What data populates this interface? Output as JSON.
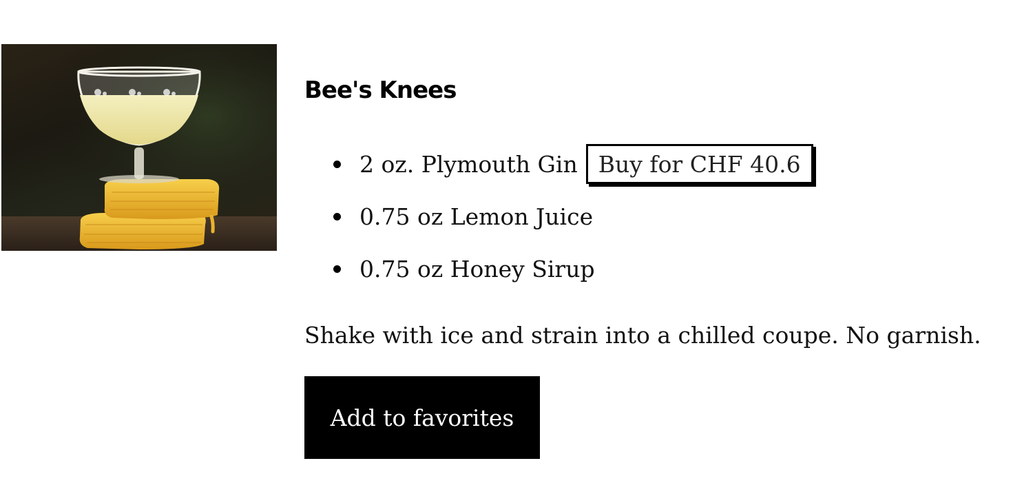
{
  "product": {
    "image": "bees-knees-cocktail-photo",
    "title": "Bee's Knees",
    "ingredients": [
      {
        "text": "2 oz. Plymouth Gin",
        "buy_label": "Buy for CHF 40.6"
      },
      {
        "text": "0.75 oz Lemon Juice"
      },
      {
        "text": "0.75 oz Honey Sirup"
      }
    ],
    "instructions": "Shake with ice and strain into a chilled coupe. No garnish.",
    "favorite_label": "Add to favorites"
  }
}
